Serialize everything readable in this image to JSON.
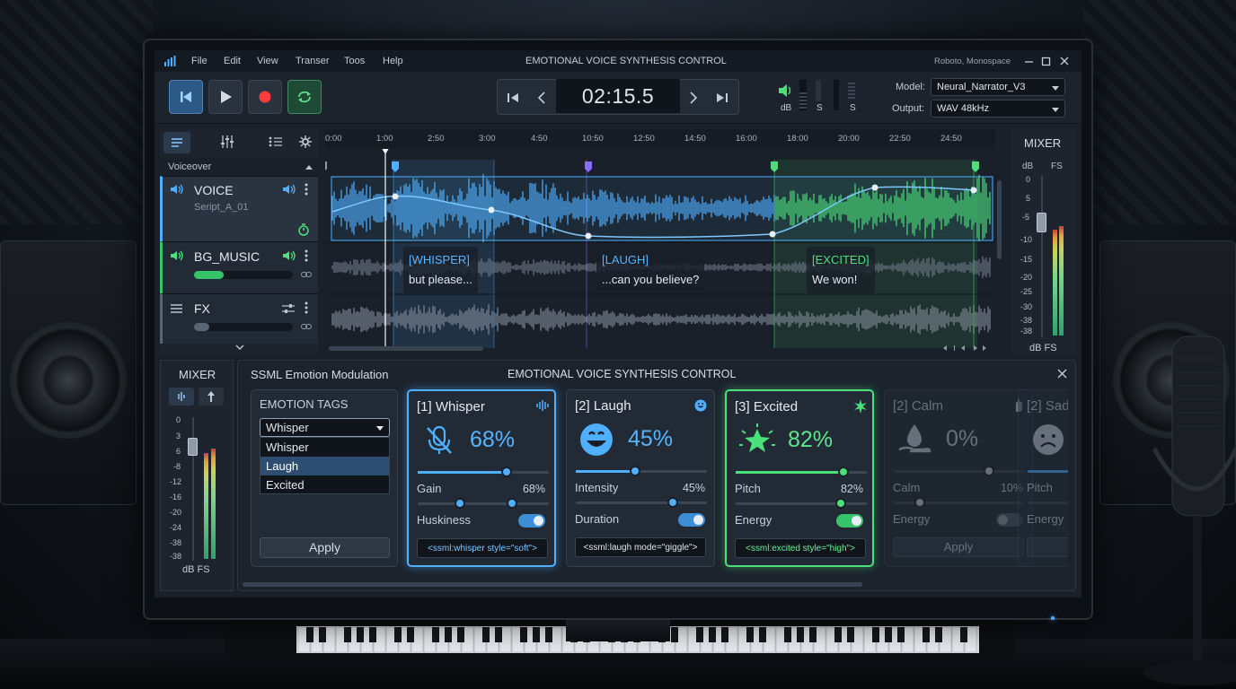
{
  "app": {
    "title": "EMOTIONAL VOICE SYNTHESIS CONTROL",
    "font_hint": "Roboto, Monospace"
  },
  "menu": [
    "File",
    "Edit",
    "View",
    "Transer",
    "Toos",
    "Help"
  ],
  "transport": {
    "time": "02:15.5"
  },
  "levels": {
    "db_label": "dB",
    "s1": "S",
    "s2": "S"
  },
  "settings": {
    "model_label": "Model:",
    "model_value": "Neural_Narrator_V3",
    "output_label": "Output:",
    "output_value": "WAV 48kHz"
  },
  "timeline": {
    "ticks": [
      "0:00",
      "1:00",
      "2:50",
      "3:00",
      "4:50",
      "10:50",
      "12:50",
      "14:50",
      "16:00",
      "18:00",
      "20:00",
      "22:50",
      "24:50"
    ],
    "group_label": "Voiceover"
  },
  "tracks": [
    {
      "name": "VOICE",
      "sub": "Seript_A_01"
    },
    {
      "name": "BG_MUSIC",
      "level": 0.3
    },
    {
      "name": "FX",
      "level": 0.15
    }
  ],
  "emotion_markers": [
    {
      "tag": "[WHISPER]",
      "text": "but please..."
    },
    {
      "tag": "[LAUGH]",
      "text": "...can you believe?"
    },
    {
      "tag": "[EXCITED]",
      "text": "We won!"
    }
  ],
  "mixer_right": {
    "title": "MIXER",
    "db": "dB",
    "fs": "FS",
    "footer": "dB FS",
    "scale": [
      "0",
      "5",
      "-5",
      "-10",
      "-15",
      "-20",
      "-25",
      "-30",
      "-38",
      "-38"
    ]
  },
  "mixer_left": {
    "title": "MIXER",
    "footer": "dB FS",
    "scale": [
      "0",
      "3",
      "6",
      "-8",
      "-12",
      "-16",
      "-20",
      "-24",
      "-38",
      "-38"
    ]
  },
  "ssml_panel": {
    "title": "SSML Emotion Modulation",
    "center_title": "EMOTIONAL VOICE SYNTHESIS CONTROL",
    "tags_title": "EMOTION TAGS",
    "dropdown_value": "Whisper",
    "options": [
      "Whisper",
      "Laugh",
      "Excited"
    ],
    "selected_option": "Laugh",
    "apply": "Apply"
  },
  "cards": [
    {
      "title": "[1] Whisper",
      "percent": "68%",
      "p1_label": "Gain",
      "p1_value": "68%",
      "p1": 0.68,
      "p2_label": "Huskiness",
      "p2": 0.72,
      "toggle": true,
      "code": "<ssml:whisper style=\"soft\">",
      "accent": "#4fb0ff"
    },
    {
      "title": "[2] Laugh",
      "percent": "45%",
      "p1_label": "Intensity",
      "p1_value": "45%",
      "p1": 0.45,
      "p2_label": "Duration",
      "p2": 0.45,
      "toggle": true,
      "code": "<ssml:laugh mode=\"giggle\">",
      "accent": "#4fb0ff"
    },
    {
      "title": "[3] Excited",
      "percent": "82%",
      "p1_label": "Pitch",
      "p1_value": "82%",
      "p1": 0.82,
      "p2_label": "Energy",
      "p2": 0.8,
      "toggle": true,
      "code": "<ssml:excited style=\"high\">",
      "accent": "#4be07a"
    },
    {
      "title": "[2] Calm",
      "percent": "0%",
      "p1_label": "Calm",
      "p1_value": "10%",
      "p1": 0.1,
      "p2_label": "Energy",
      "p2": 0.2,
      "toggle": false,
      "apply": "Apply"
    },
    {
      "title": "[2] Sad",
      "p1_label": "Pitch",
      "p2_label": "Energy"
    }
  ]
}
